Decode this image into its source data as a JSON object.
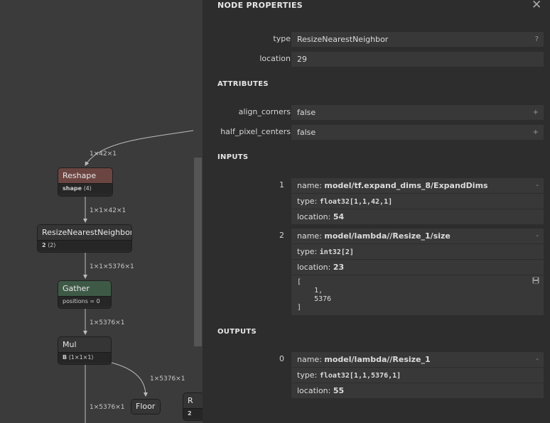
{
  "graph": {
    "nodes": {
      "reshape": {
        "title": "Reshape",
        "attr_name": "shape",
        "attr_value": "⟨4⟩"
      },
      "resize": {
        "title": "ResizeNearestNeighbor",
        "attr_name": "2",
        "attr_value": "⟨2⟩"
      },
      "gather": {
        "title": "Gather",
        "attr_name": "positions = 0",
        "attr_value": ""
      },
      "mul": {
        "title": "Mul",
        "attr_name": "B",
        "attr_value": "⟨1×1×1⟩"
      },
      "floor": {
        "title": "Floor"
      },
      "partial": {
        "title": "R",
        "attr_name": "2",
        "attr_value": ""
      }
    },
    "edges": {
      "e1": "1×42×1",
      "e2": "1×1×42×1",
      "e3": "1×1×5376×1",
      "e4": "1×5376×1",
      "e5": "1×5376×1",
      "e6": "1×5376×1"
    }
  },
  "panel": {
    "title": "NODE PROPERTIES",
    "close_icon": "close-icon",
    "properties": {
      "type_label": "type",
      "type_value": "ResizeNearestNeighbor",
      "type_help": "?",
      "location_label": "location",
      "location_value": "29"
    },
    "attributes": {
      "title": "ATTRIBUTES",
      "items": [
        {
          "label": "align_corners",
          "value": "false",
          "action": "+"
        },
        {
          "label": "half_pixel_centers",
          "value": "false",
          "action": "+"
        }
      ]
    },
    "inputs": {
      "title": "INPUTS",
      "items": [
        {
          "index": "1",
          "name_label": "name: ",
          "name": "model/tf.expand_dims_8/ExpandDims",
          "action": "-",
          "type_label": "type: ",
          "type": "float32[1,1,42,1]",
          "location_label": "location: ",
          "location": "54"
        },
        {
          "index": "2",
          "name_label": "name: ",
          "name": "model/lambda//Resize_1/size",
          "action": "-",
          "type_label": "type: ",
          "type": "int32[2]",
          "location_label": "location: ",
          "location": "23",
          "tensor": "[\n    1,\n    5376\n]"
        }
      ]
    },
    "outputs": {
      "title": "OUTPUTS",
      "items": [
        {
          "index": "0",
          "name_label": "name: ",
          "name": "model/lambda//Resize_1",
          "action": "-",
          "type_label": "type: ",
          "type": "float32[1,1,5376,1]",
          "location_label": "location: ",
          "location": "55"
        }
      ]
    }
  },
  "colors": {
    "reshape_head": "#6b4541",
    "gather_head": "#3e5a47",
    "default_head": "#353535"
  }
}
